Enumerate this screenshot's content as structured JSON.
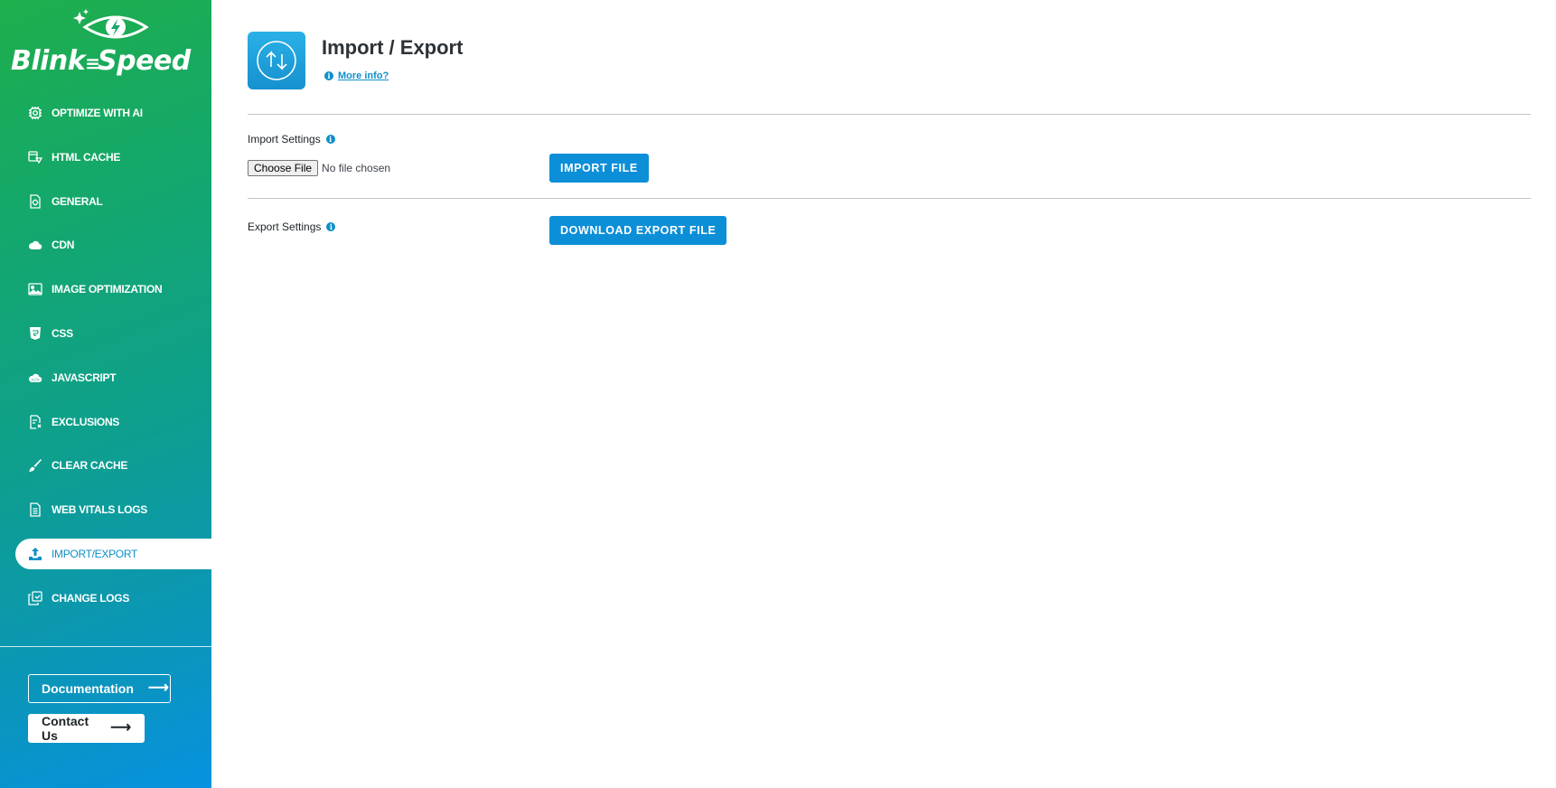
{
  "brand": {
    "name_part1": "Blink",
    "name_part2": "Speed"
  },
  "sidebar": {
    "items": [
      {
        "label": "OPTIMIZE WITH AI",
        "icon": "chip-icon"
      },
      {
        "label": "HTML CACHE",
        "icon": "cache-icon"
      },
      {
        "label": "GENERAL",
        "icon": "settings-doc-icon"
      },
      {
        "label": "CDN",
        "icon": "cloud-icon"
      },
      {
        "label": "IMAGE OPTIMIZATION",
        "icon": "image-icon"
      },
      {
        "label": "CSS",
        "icon": "css-icon"
      },
      {
        "label": "JAVASCRIPT",
        "icon": "js-icon"
      },
      {
        "label": "EXCLUSIONS",
        "icon": "exclusions-icon"
      },
      {
        "label": "CLEAR CACHE",
        "icon": "brush-icon"
      },
      {
        "label": "WEB VITALS LOGS",
        "icon": "log-file-icon"
      },
      {
        "label": "IMPORT/EXPORT",
        "icon": "upload-icon",
        "active": true
      },
      {
        "label": "CHANGE LOGS",
        "icon": "copy-icon"
      }
    ],
    "documentation_label": "Documentation",
    "contact_label": "Contact Us"
  },
  "main": {
    "title": "Import / Export",
    "more_info": "More info?",
    "import": {
      "label": "Import Settings",
      "choose_file": "Choose File",
      "no_file": "No file chosen",
      "button": "IMPORT FILE"
    },
    "export": {
      "label": "Export Settings",
      "button": "DOWNLOAD EXPORT FILE"
    }
  },
  "colors": {
    "accent": "#0d8fd8",
    "sidebar_top": "#1fae4c",
    "sidebar_bottom": "#0891e0"
  }
}
